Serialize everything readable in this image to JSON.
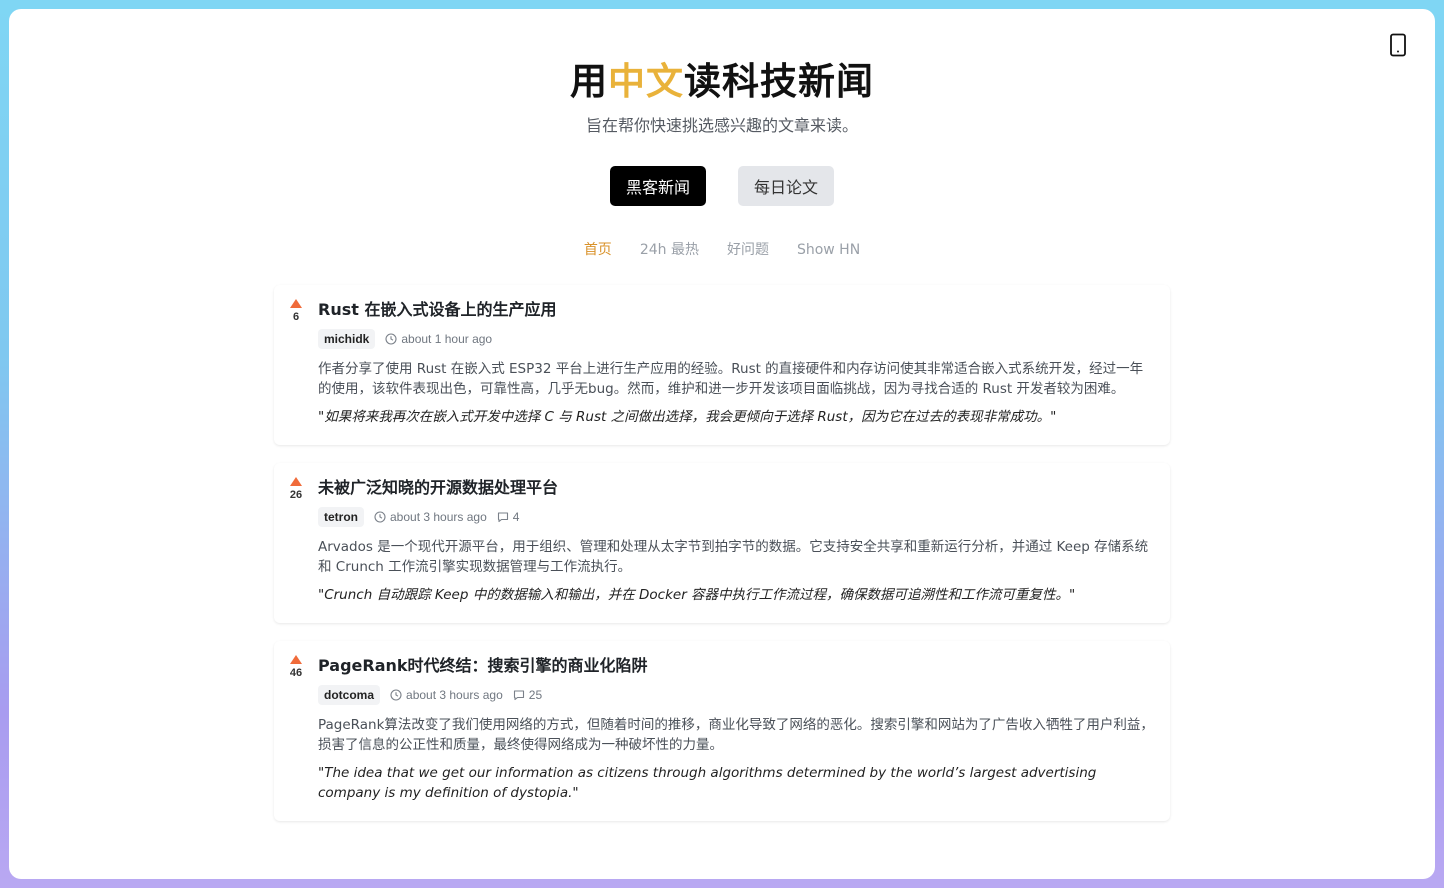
{
  "hero": {
    "title_prefix": "用",
    "title_accent": "中文",
    "title_suffix": "读科技新闻",
    "subtitle": "旨在帮你快速挑选感兴趣的文章来读。"
  },
  "switch": {
    "hn_label": "黑客新闻",
    "paper_label": "每日论文"
  },
  "tabs": [
    {
      "label": "首页",
      "active": true
    },
    {
      "label": "24h 最热",
      "active": false
    },
    {
      "label": "好问题",
      "active": false
    },
    {
      "label": "Show HN",
      "active": false
    }
  ],
  "stories": [
    {
      "points": "6",
      "title": "Rust 在嵌入式设备上的生产应用",
      "author": "michidk",
      "time": "about 1 hour ago",
      "comments": "",
      "summary": "作者分享了使用 Rust 在嵌入式 ESP32 平台上进行生产应用的经验。Rust 的直接硬件和内存访问使其非常适合嵌入式系统开发，经过一年的使用，该软件表现出色，可靠性高，几乎无bug。然而，维护和进一步开发该项目面临挑战，因为寻找合适的 Rust 开发者较为困难。",
      "quote": "\"如果将来我再次在嵌入式开发中选择 C 与 Rust 之间做出选择，我会更倾向于选择 Rust，因为它在过去的表现非常成功。\""
    },
    {
      "points": "26",
      "title": "未被广泛知晓的开源数据处理平台",
      "author": "tetron",
      "time": "about 3 hours ago",
      "comments": "4",
      "summary": "Arvados 是一个现代开源平台，用于组织、管理和处理从太字节到拍字节的数据。它支持安全共享和重新运行分析，并通过 Keep 存储系统和 Crunch 工作流引擎实现数据管理与工作流执行。",
      "quote": "\"Crunch 自动跟踪 Keep 中的数据输入和输出，并在 Docker 容器中执行工作流过程，确保数据可追溯性和工作流可重复性。\""
    },
    {
      "points": "46",
      "title": "PageRank时代终结：搜索引擎的商业化陷阱",
      "author": "dotcoma",
      "time": "about 3 hours ago",
      "comments": "25",
      "summary": "PageRank算法改变了我们使用网络的方式，但随着时间的推移，商业化导致了网络的恶化。搜索引擎和网站为了广告收入牺牲了用户利益，损害了信息的公正性和质量，最终使得网络成为一种破坏性的力量。",
      "quote": "\"The idea that we get our information as citizens through algorithms determined by the world’s largest advertising company is my definition of dystopia.\""
    }
  ]
}
